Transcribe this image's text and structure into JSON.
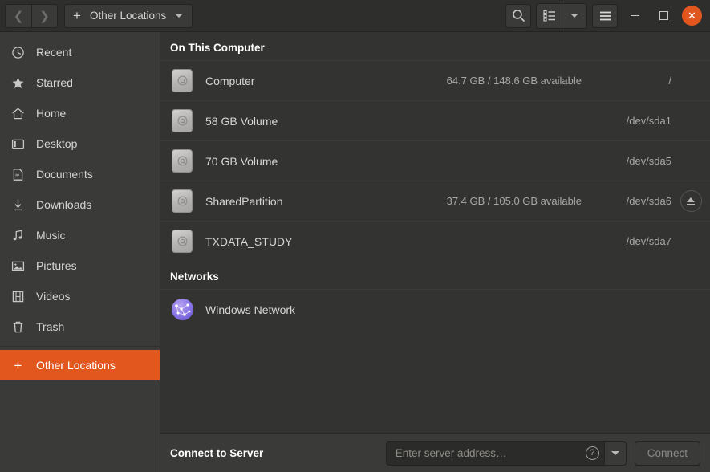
{
  "window": {
    "title": "Other Locations",
    "accent_color": "#e2571e",
    "sidebar_bg": "#3a3a38",
    "main_bg": "#333331"
  },
  "header": {
    "back_icon": "chevron-left-icon",
    "forward_icon": "chevron-right-icon",
    "path_plus": "+",
    "path_label": "Other Locations",
    "search_icon": "search-icon",
    "view_list_icon": "list-view-icon",
    "view_dropdown_icon": "chevron-down-icon",
    "menu_icon": "hamburger-menu-icon",
    "minimize_label": "",
    "maximize_label": "",
    "close_label": "✕"
  },
  "sidebar": {
    "items": [
      {
        "label": "Recent",
        "icon": "clock-icon",
        "selected": false
      },
      {
        "label": "Starred",
        "icon": "star-icon",
        "selected": false
      },
      {
        "label": "Home",
        "icon": "home-icon",
        "selected": false
      },
      {
        "label": "Desktop",
        "icon": "desktop-icon",
        "selected": false
      },
      {
        "label": "Documents",
        "icon": "document-icon",
        "selected": false
      },
      {
        "label": "Downloads",
        "icon": "download-icon",
        "selected": false
      },
      {
        "label": "Music",
        "icon": "music-note-icon",
        "selected": false
      },
      {
        "label": "Pictures",
        "icon": "picture-icon",
        "selected": false
      },
      {
        "label": "Videos",
        "icon": "film-icon",
        "selected": false
      },
      {
        "label": "Trash",
        "icon": "trash-icon",
        "selected": false
      },
      {
        "label": "Other Locations",
        "icon": "plus-icon",
        "selected": true
      }
    ]
  },
  "main": {
    "groups": [
      {
        "title": "On This Computer",
        "rows": [
          {
            "name": "Computer",
            "free": "64.7 GB / 148.6 GB available",
            "device": "/",
            "icon": "hard-drive-icon",
            "eject": false
          },
          {
            "name": "58 GB Volume",
            "free": "",
            "device": "/dev/sda1",
            "icon": "hard-drive-icon",
            "eject": false
          },
          {
            "name": "70 GB Volume",
            "free": "",
            "device": "/dev/sda5",
            "icon": "hard-drive-icon",
            "eject": false
          },
          {
            "name": "SharedPartition",
            "free": "37.4 GB / 105.0 GB available",
            "device": "/dev/sda6",
            "icon": "hard-drive-icon",
            "eject": true
          },
          {
            "name": "TXDATA_STUDY",
            "free": "",
            "device": "/dev/sda7",
            "icon": "hard-drive-icon",
            "eject": false
          }
        ]
      },
      {
        "title": "Networks",
        "rows": [
          {
            "name": "Windows Network",
            "free": "",
            "device": "",
            "icon": "network-globe-icon",
            "eject": false
          }
        ]
      }
    ]
  },
  "footer": {
    "label": "Connect to Server",
    "input_value": "",
    "input_placeholder": "Enter server address…",
    "help_icon": "help-circle-icon",
    "dropdown_icon": "chevron-down-icon",
    "connect_label": "Connect"
  }
}
